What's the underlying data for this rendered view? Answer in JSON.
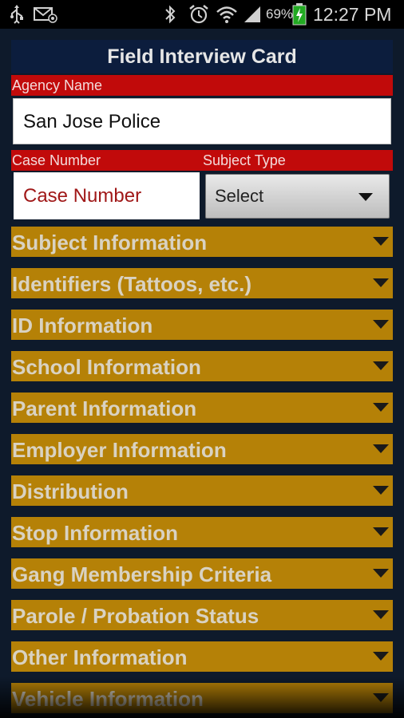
{
  "status_bar": {
    "battery_percent": "69%",
    "time": "12:27 PM",
    "icons": [
      "usb-icon",
      "mail-icon",
      "bluetooth-icon",
      "alarm-icon",
      "wifi-icon",
      "signal-icon",
      "battery-charging-icon"
    ]
  },
  "form": {
    "title": "Field Interview Card",
    "agency_label": "Agency Name",
    "agency_value": "San Jose Police",
    "case_label": "Case Number",
    "case_placeholder": "Case Number",
    "subject_type_label": "Subject Type",
    "subject_type_value": "Select"
  },
  "sections": [
    {
      "label": "Subject Information"
    },
    {
      "label": "Identifiers (Tattoos, etc.)"
    },
    {
      "label": "ID Information"
    },
    {
      "label": "School Information"
    },
    {
      "label": "Parent Information"
    },
    {
      "label": "Employer Information"
    },
    {
      "label": "Distribution"
    },
    {
      "label": "Stop Information"
    },
    {
      "label": "Gang Membership Criteria"
    },
    {
      "label": "Parole / Probation Status"
    },
    {
      "label": "Other Information"
    },
    {
      "label": "Vehicle Information"
    }
  ],
  "colors": {
    "background": "#0e1a2b",
    "title_bar": "#0c1d3d",
    "label_bar": "#c10a0a",
    "section_bar": "#b58107",
    "section_text": "#d9d2c2"
  }
}
